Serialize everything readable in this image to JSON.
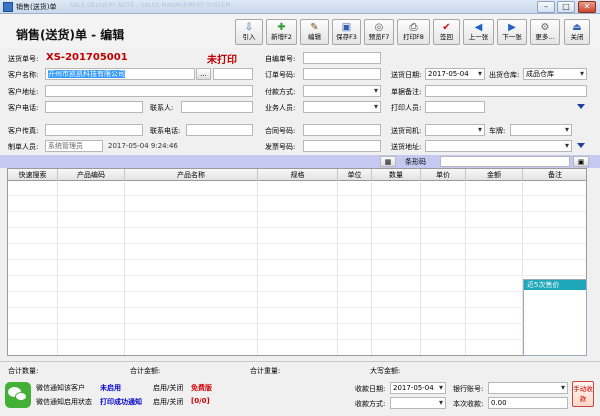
{
  "window": {
    "title": "销售(送货)单",
    "faded_title": "SALE DELIVERY NOTE - SALES MANAGEMENT SYSTEM"
  },
  "header": {
    "doc_title": "销售(送货)单  -  编辑"
  },
  "toolbar": [
    {
      "label": "引入",
      "icon": "import-icon",
      "glyph": "⇩",
      "color": "#2f5fb3"
    },
    {
      "label": "新增F2",
      "icon": "new-doc-icon",
      "glyph": "✚",
      "color": "#2f9a33"
    },
    {
      "label": "编辑",
      "icon": "edit-icon",
      "glyph": "✎",
      "color": "#7a4a12"
    },
    {
      "label": "保存F3",
      "icon": "save-icon",
      "glyph": "▣",
      "color": "#2f5fb3"
    },
    {
      "label": "预览F7",
      "icon": "preview-icon",
      "glyph": "◎",
      "color": "#555555"
    },
    {
      "label": "打印F8",
      "icon": "printer-icon",
      "glyph": "⎙",
      "color": "#333333"
    },
    {
      "label": "签回",
      "icon": "check-icon",
      "glyph": "✔",
      "color": "#d01010"
    },
    {
      "label": "上一张",
      "icon": "prev-icon",
      "glyph": "◀",
      "color": "#1f60c4"
    },
    {
      "label": "下一张",
      "icon": "next-icon",
      "glyph": "▶",
      "color": "#1f60c4"
    },
    {
      "label": "更多...",
      "icon": "more-icon",
      "glyph": "⚙",
      "color": "#666666"
    },
    {
      "label": "关闭",
      "icon": "close-door-icon",
      "glyph": "⏏",
      "color": "#2f5fb3"
    }
  ],
  "form": {
    "doc_no_label": "送货单号:",
    "doc_no": "XS-201705001",
    "print_status": "未打印",
    "self_no_label": "自编单号:",
    "customer_label": "客户名称:",
    "customer_value": "开州市凯凯科技有限公司",
    "lookup_label": "...",
    "order_no_label": "订单号码:",
    "ship_date_label": "送货日期:",
    "ship_date": "2017-05-04",
    "warehouse_label": "出货仓库:",
    "warehouse": "成品仓库",
    "address_label": "客户地址:",
    "payment_label": "付款方式:",
    "remark_label": "单据备注:",
    "phone_label": "客户电话:",
    "contact_label": "联系人:",
    "salesman_label": "业务人员:",
    "printer_label": "打印人员:",
    "fax_label": "客户传真:",
    "contact_phone_label": "联系电话:",
    "contract_label": "合同号码:",
    "driver_label": "送货司机:",
    "vehicle_label": "车牌:",
    "creator_label": "制单人员:",
    "creator_value": "系统管理员",
    "created_at": "2017-05-04 9:24:46",
    "invoice_label": "发票号码:",
    "ship_addr_label": "送货地址:",
    "barcode_label": "条形码"
  },
  "grid": {
    "columns": [
      "快速搜索",
      "产品编码",
      "产品名称",
      "规格",
      "单位",
      "数量",
      "单价",
      "金额",
      "备注"
    ]
  },
  "side_panel": {
    "title": "近5次售价"
  },
  "totals": {
    "qty_label": "合计数量:",
    "amount_label": "合计金额:",
    "weight_label": "合计重量:",
    "capital_label": "大写金额:"
  },
  "bottom": {
    "wx_customer_label": "微信通知该客户",
    "wx_customer_status": "未启用",
    "toggle1_label": "启用/关闭",
    "free_label": "免费版",
    "wx_enable_label": "微信通知启用状态",
    "wx_enable_status": "打印成功通知",
    "toggle2_label": "启用/关闭",
    "count_label": "[0/0]",
    "pay_date_label": "收款日期:",
    "pay_date": "2017-05-04",
    "pay_method_label": "收款方式:",
    "bank_label": "银行账号:",
    "this_pay_label": "本次收款:",
    "this_pay_value": "0.00",
    "manual_label": "手动收款"
  }
}
